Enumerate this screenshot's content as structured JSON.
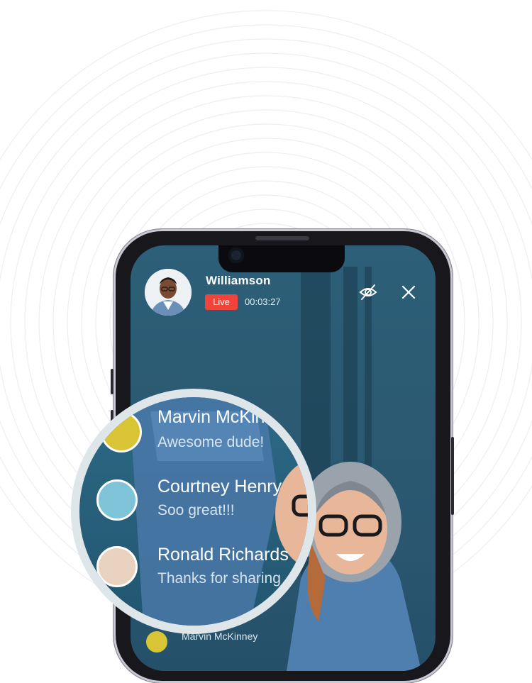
{
  "host": {
    "name": "Williamson",
    "live_label": "Live",
    "timer": "00:03:27"
  },
  "icons": {
    "hide": "eye-off-icon",
    "close": "close-icon"
  },
  "colors": {
    "live": "#f0433a",
    "screen": "#2b5a72"
  },
  "comments": [
    {
      "name": "Marvin McKinney",
      "text": "Awesome dude!"
    },
    {
      "name": "Courtney Henry",
      "text": "Soo great!!!"
    },
    {
      "name": "Ronald Richards",
      "text": "Thanks for sharing"
    }
  ],
  "bottom_comment": {
    "name": "Marvin McKinney"
  }
}
